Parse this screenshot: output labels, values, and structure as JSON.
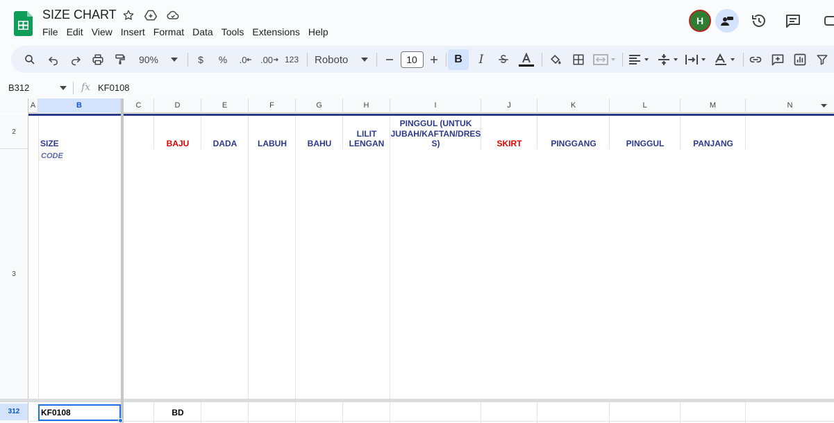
{
  "app": {
    "title": "SIZE CHART",
    "menu": [
      "File",
      "Edit",
      "View",
      "Insert",
      "Format",
      "Data",
      "Tools",
      "Extensions",
      "Help"
    ],
    "avatar_initial": "H"
  },
  "toolbar": {
    "zoom": "90%",
    "currency": "$",
    "percent": "%",
    "dec_decrease": ".0",
    "dec_increase": ".00",
    "number_format": "123",
    "font": "Roboto",
    "font_size": "10",
    "bold": "B",
    "italic": "I"
  },
  "formula_bar": {
    "name_box": "B312",
    "fx": "fx",
    "value": "KF0108"
  },
  "columns": [
    "A",
    "B",
    "C",
    "D",
    "E",
    "F",
    "G",
    "H",
    "I",
    "J",
    "K",
    "L",
    "M",
    "N"
  ],
  "rows": [
    "2",
    "3",
    "312"
  ],
  "header_row": {
    "size": "SIZE",
    "code": "CODE",
    "baju": "BAJU",
    "dada": "DADA",
    "labuh": "LABUH",
    "bahu": "BAHU",
    "lilit_lengan_1": "LILIT",
    "lilit_lengan_2": "LENGAN",
    "pinggul_long_1": "PINGGUL (UNTUK",
    "pinggul_long_2": "JUBAH/KAFTAN/DRES",
    "pinggul_long_3": "S)",
    "skirt": "SKIRT",
    "pinggang": "PINGGANG",
    "pinggul": "PINGGUL",
    "panjang": "PANJANG"
  },
  "data_row": {
    "b": "KF0108",
    "d": "BD"
  },
  "colors": {
    "accent": "#2c3a8c",
    "red_label": "#e00000",
    "selection": "#1a73e8",
    "sheets_green": "#0f9d58"
  }
}
